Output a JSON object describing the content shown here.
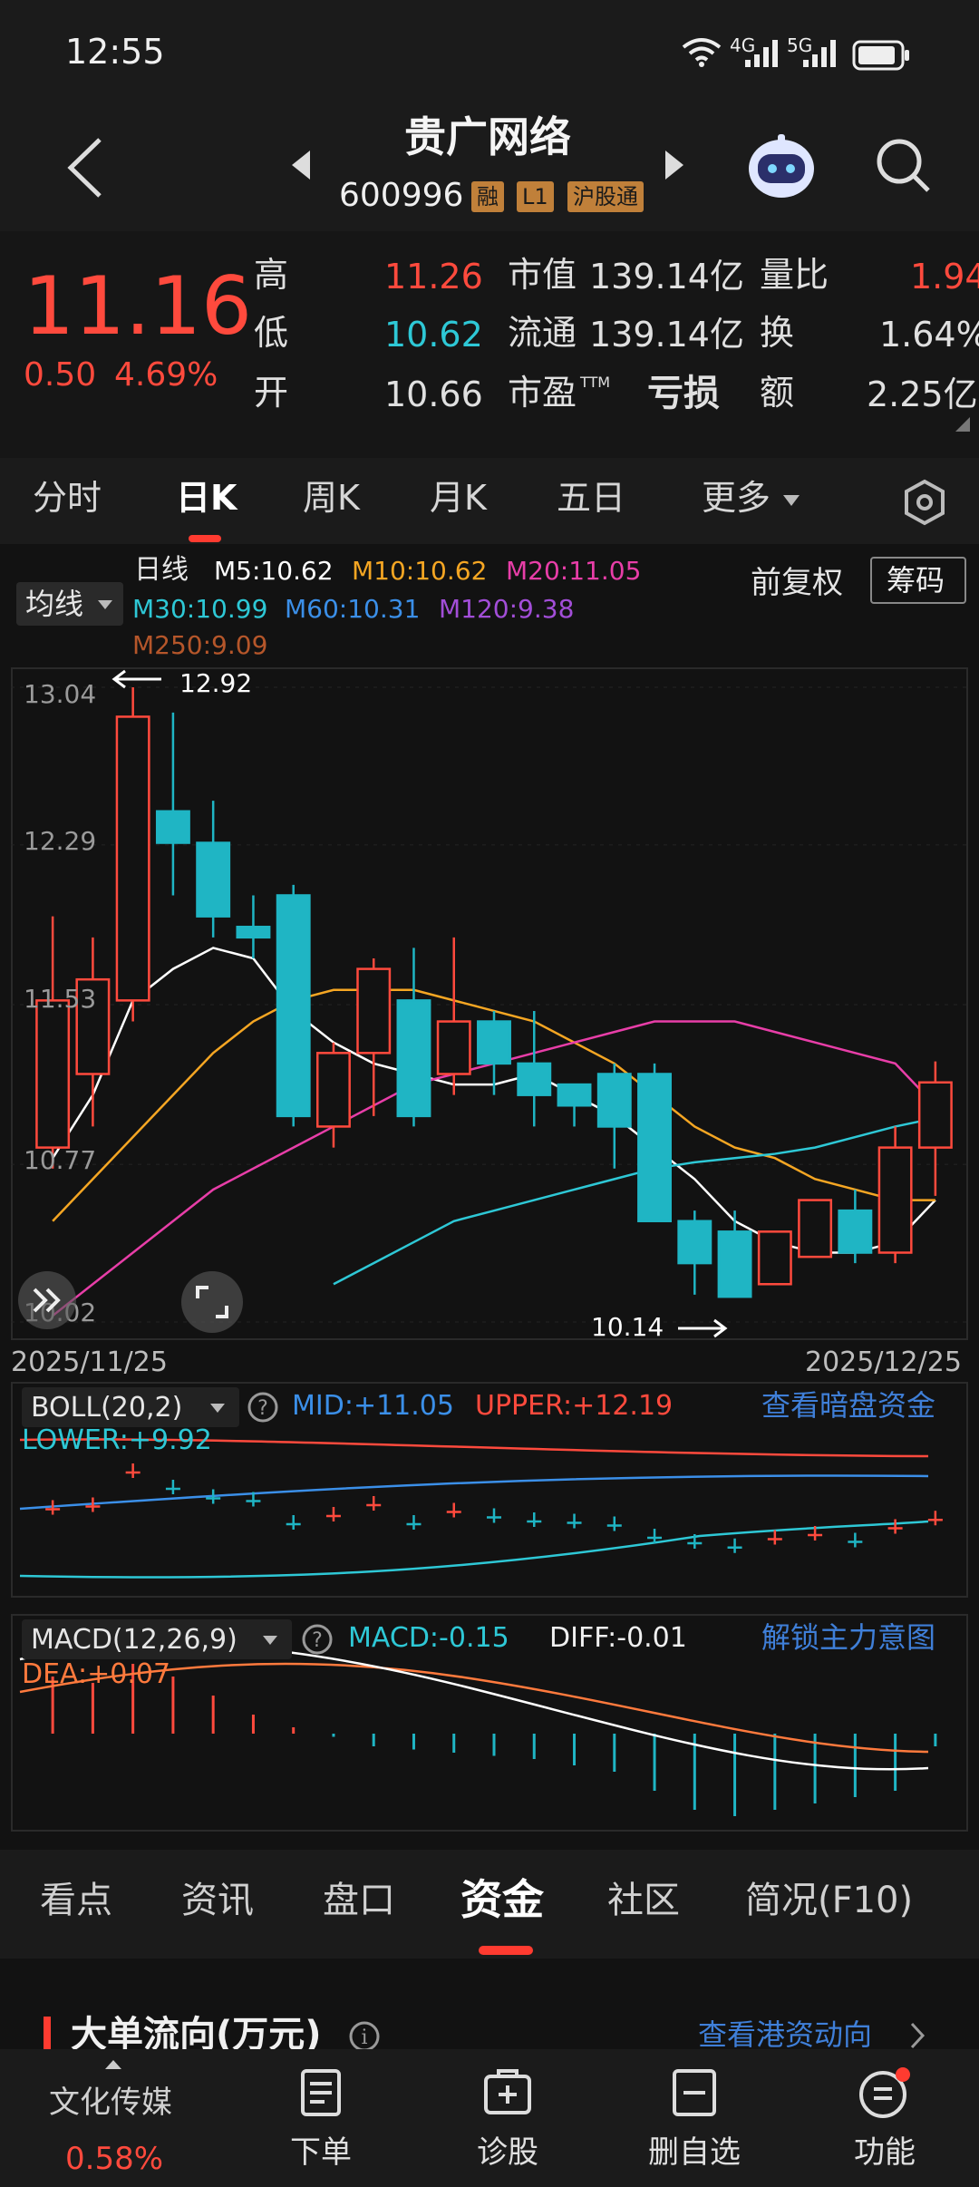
{
  "status_bar": {
    "time": "12:55",
    "network_1": "4G",
    "network_2": "5G"
  },
  "header": {
    "title": "贵广网络",
    "code": "600996",
    "badges": [
      "融",
      "L1",
      "沪股通"
    ]
  },
  "quote": {
    "price": "11.16",
    "change": "0.50",
    "change_pct": "4.69%",
    "high_label": "高",
    "high_value": "11.26",
    "low_label": "低",
    "low_value": "10.62",
    "open_label": "开",
    "open_value": "10.66",
    "mktcap_label": "市值",
    "mktcap_value": "139.14亿",
    "float_label": "流通",
    "float_value": "139.14亿",
    "pe_label": "市盈",
    "pe_sup": "TTM",
    "pe_value": "亏损",
    "volratio_label": "量比",
    "volratio_value": "1.94",
    "turnover_label": "换",
    "turnover_value": "1.64%",
    "amount_label": "额",
    "amount_value": "2.25亿"
  },
  "tabs": {
    "items": [
      "分时",
      "日K",
      "周K",
      "月K",
      "五日",
      "更多"
    ],
    "active": "日K"
  },
  "ma_legend": {
    "selector": "均线",
    "period": "日线",
    "m5": "M5:10.62",
    "m10": "M10:10.62",
    "m20": "M20:11.05",
    "m30": "M30:10.99",
    "m60": "M60:10.31",
    "m120": "M120:9.38",
    "m250": "M250:9.09",
    "adjust": "前复权",
    "chips": "筹码"
  },
  "colors": {
    "up": "#ff4a3d",
    "down": "#1fb5c4",
    "m5": "#ffffff",
    "m10": "#f5a623",
    "m20": "#e83ea8",
    "m30": "#2ec8d6",
    "m60": "#3b8fe8",
    "m120": "#a24ed8",
    "m250": "#b5562a",
    "blue_link": "#3f7fd8"
  },
  "kline": {
    "price_max_label": "12.92",
    "price_min_label": "10.14",
    "date_start": "2025/11/25",
    "date_end": "2025/12/25"
  },
  "boll": {
    "name": "BOLL(20,2)",
    "mid": "MID:+11.05",
    "upper": "UPPER:+12.19",
    "lower": "LOWER:+9.92",
    "link": "查看暗盘资金"
  },
  "macd": {
    "name": "MACD(12,26,9)",
    "macd": "MACD:-0.15",
    "diff": "DIFF:-0.01",
    "dea": "DEA:+0.07",
    "link": "解锁主力意图"
  },
  "bottom_tabs": {
    "items": [
      "看点",
      "资讯",
      "盘口",
      "资金",
      "社区",
      "简况(F10)"
    ],
    "active": "资金"
  },
  "section": {
    "title": "大单流向(万元)",
    "link": "查看港资动向"
  },
  "navbar": {
    "sector_name": "文化传媒",
    "sector_change": "0.58%",
    "items": [
      "下单",
      "诊股",
      "删自选",
      "功能"
    ]
  },
  "chart_data": {
    "type": "candlestick",
    "x_range": [
      "2025/11/25",
      "2025/12/25"
    ],
    "y_ticks": [
      13.04,
      12.29,
      11.53,
      10.77,
      10.02
    ],
    "ylim": [
      10.02,
      13.04
    ],
    "candles": [
      {
        "open": 10.85,
        "close": 11.55,
        "high": 11.95,
        "low": 10.75
      },
      {
        "open": 11.2,
        "close": 11.65,
        "high": 11.85,
        "low": 10.95
      },
      {
        "open": 11.55,
        "close": 12.9,
        "high": 13.04,
        "low": 11.45
      },
      {
        "open": 12.45,
        "close": 12.3,
        "high": 12.92,
        "low": 12.05
      },
      {
        "open": 12.3,
        "close": 11.95,
        "high": 12.5,
        "low": 11.85
      },
      {
        "open": 11.9,
        "close": 11.85,
        "high": 12.05,
        "low": 11.75
      },
      {
        "open": 12.05,
        "close": 11.0,
        "high": 12.1,
        "low": 10.95
      },
      {
        "open": 10.95,
        "close": 11.3,
        "high": 11.35,
        "low": 10.85
      },
      {
        "open": 11.3,
        "close": 11.7,
        "high": 11.75,
        "low": 11.0
      },
      {
        "open": 11.55,
        "close": 11.0,
        "high": 11.8,
        "low": 10.95
      },
      {
        "open": 11.2,
        "close": 11.45,
        "high": 11.85,
        "low": 11.1
      },
      {
        "open": 11.45,
        "close": 11.25,
        "high": 11.5,
        "low": 11.1
      },
      {
        "open": 11.25,
        "close": 11.1,
        "high": 11.5,
        "low": 10.95
      },
      {
        "open": 11.15,
        "close": 11.05,
        "high": 11.15,
        "low": 10.95
      },
      {
        "open": 11.2,
        "close": 10.95,
        "high": 11.25,
        "low": 10.75
      },
      {
        "open": 11.2,
        "close": 10.5,
        "high": 11.25,
        "low": 10.5
      },
      {
        "open": 10.5,
        "close": 10.3,
        "high": 10.55,
        "low": 10.15
      },
      {
        "open": 10.45,
        "close": 10.14,
        "high": 10.55,
        "low": 10.14
      },
      {
        "open": 10.2,
        "close": 10.45,
        "high": 10.45,
        "low": 10.2
      },
      {
        "open": 10.33,
        "close": 10.6,
        "high": 10.6,
        "low": 10.33
      },
      {
        "open": 10.55,
        "close": 10.35,
        "high": 10.65,
        "low": 10.3
      },
      {
        "open": 10.35,
        "close": 10.85,
        "high": 10.95,
        "low": 10.3
      },
      {
        "open": 10.85,
        "close": 11.16,
        "high": 11.26,
        "low": 10.62
      }
    ],
    "series": [
      {
        "name": "M5",
        "values": [
          10.8,
          11.1,
          11.55,
          11.7,
          11.8,
          11.75,
          11.5,
          11.35,
          11.25,
          11.2,
          11.15,
          11.15,
          11.2,
          11.1,
          11.0,
          10.85,
          10.7,
          10.5,
          10.4,
          10.35,
          10.35,
          10.4,
          10.6
        ]
      },
      {
        "name": "M10",
        "values": [
          10.5,
          10.7,
          10.9,
          11.1,
          11.3,
          11.45,
          11.55,
          11.6,
          11.6,
          11.6,
          11.55,
          11.5,
          11.45,
          11.35,
          11.25,
          11.1,
          10.95,
          10.85,
          10.8,
          10.7,
          10.65,
          10.6,
          10.6
        ]
      },
      {
        "name": "M20",
        "values": [
          10.05,
          10.2,
          10.35,
          10.5,
          10.65,
          10.75,
          10.85,
          10.95,
          11.05,
          11.15,
          11.2,
          11.25,
          11.3,
          11.35,
          11.4,
          11.45,
          11.45,
          11.45,
          11.4,
          11.35,
          11.3,
          11.25,
          11.05
        ]
      },
      {
        "name": "M30",
        "values": [
          null,
          null,
          null,
          null,
          null,
          null,
          null,
          10.2,
          10.3,
          10.4,
          10.5,
          10.55,
          10.6,
          10.65,
          10.7,
          10.75,
          10.78,
          10.8,
          10.82,
          10.85,
          10.9,
          10.95,
          10.99
        ]
      }
    ]
  }
}
